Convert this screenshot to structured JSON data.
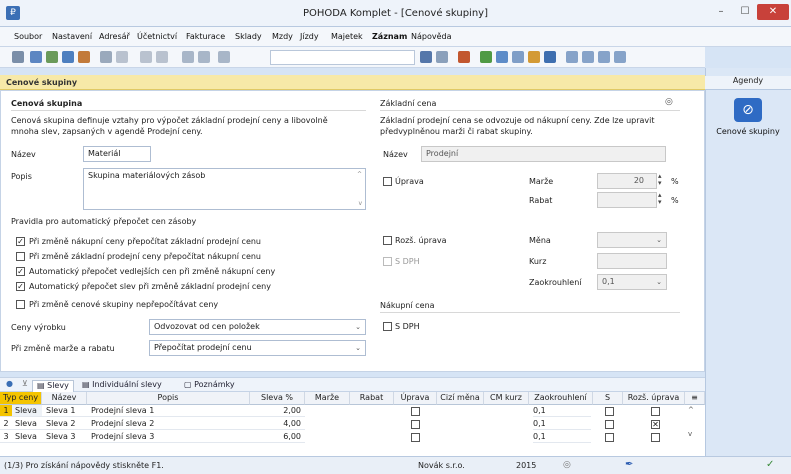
{
  "window": {
    "title": "POHODA Komplet - [Cenové skupiny]"
  },
  "menu": [
    {
      "label": "Soubor"
    },
    {
      "label": "Nastavení"
    },
    {
      "label": "Adresář"
    },
    {
      "label": "Účetnictví"
    },
    {
      "label": "Fakturace"
    },
    {
      "label": "Sklady"
    },
    {
      "label": "Mzdy"
    },
    {
      "label": "Jízdy"
    },
    {
      "label": "Majetek"
    },
    {
      "label": "Záznam"
    },
    {
      "label": "Nápověda"
    }
  ],
  "header": {
    "title": "Cenové skupiny"
  },
  "left": {
    "section_title": "Cenová skupina",
    "description": "Cenová skupina definuje vztahy pro výpočet základní prodejní ceny a libovolně mnoha slev, zapsaných v agendě Prodejní ceny.",
    "name_label": "Název",
    "name_value": "Materiál",
    "desc_label": "Popis",
    "desc_value": "Skupina materiálových zásob",
    "rules_title": "Pravidla pro automatický přepočet cen zásoby",
    "checks": [
      {
        "label": "Při změně nákupní ceny přepočítat základní prodejní cenu",
        "checked": true
      },
      {
        "label": "Při změně základní prodejní ceny přepočítat nákupní cenu",
        "checked": false
      },
      {
        "label": "Automatický přepočet vedlejších cen při změně nákupní ceny",
        "checked": true
      },
      {
        "label": "Automatický přepočet slev při změně základní prodejní ceny",
        "checked": true
      },
      {
        "label": "Při změně cenové skupiny nepřepočítávat ceny",
        "checked": false
      }
    ],
    "prices_label": "Ceny výrobku",
    "prices_value": "Odvozovat od cen položek",
    "margin_label": "Při změně marže a rabatu",
    "margin_value": "Přepočítat prodejní cenu"
  },
  "right": {
    "section_title": "Základní cena",
    "description": "Základní prodejní cena se odvozuje od nákupní ceny. Zde lze upravit předvyplněnou marži či rabat skupiny.",
    "name_label": "Název",
    "name_value": "Prodejní",
    "uprava_label": "Úprava",
    "marze_label": "Marže",
    "marze_value": "20",
    "rabat_label": "Rabat",
    "percent": "%",
    "rozs_label": "Rozš. úprava",
    "sdph_label": "S DPH",
    "mena_label": "Měna",
    "kurz_label": "Kurz",
    "zaokr_label": "Zaokrouhlení",
    "zaokr_value": "0,1",
    "nakupni_title": "Nákupní cena",
    "nakupni_sdph": "S DPH"
  },
  "sidebar": {
    "title": "Agendy",
    "item": "Cenové skupiny"
  },
  "tabs": [
    {
      "label": "Slevy"
    },
    {
      "label": "Individuální slevy"
    },
    {
      "label": "Poznámky"
    }
  ],
  "grid": {
    "headers": [
      "Typ ceny",
      "Název",
      "Popis",
      "Sleva %",
      "Marže",
      "Rabat",
      "Úprava",
      "Cizí měna",
      "CM kurz",
      "Zaokrouhlení",
      "S",
      "Rozš. úprava"
    ],
    "rows": [
      {
        "n": "1",
        "typ": "Sleva",
        "nazev": "Sleva 1",
        "popis": "Prodejní sleva 1",
        "sleva": "2,00",
        "zaokr": "0,1",
        "rozs": false
      },
      {
        "n": "2",
        "typ": "Sleva",
        "nazev": "Sleva 2",
        "popis": "Prodejní sleva 2",
        "sleva": "4,00",
        "zaokr": "0,1",
        "rozs": true
      },
      {
        "n": "3",
        "typ": "Sleva",
        "nazev": "Sleva 3",
        "popis": "Prodejní sleva 3",
        "sleva": "6,00",
        "zaokr": "0,1",
        "rozs": false
      }
    ]
  },
  "status": {
    "hint": "(1/3) Pro získání nápovědy stiskněte F1.",
    "company": "Novák s.r.o.",
    "year": "2015"
  }
}
